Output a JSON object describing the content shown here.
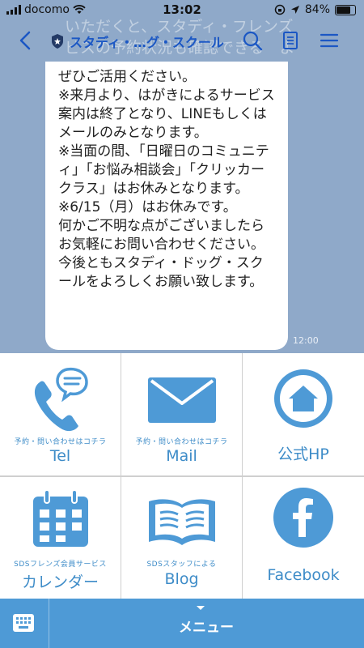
{
  "status": {
    "carrier": "docomo",
    "time": "13:02",
    "battery": "84%",
    "battery_level": 0.84
  },
  "header": {
    "title": "スタディ・…グ・スクール",
    "background_text": "いただくと、スタディ・フレンズ　ビスの予約状況も確認できる　ようになりました。"
  },
  "message": {
    "lines": [
      "ぜひご活用ください。",
      "",
      "※来月より、はがきによるサービス案内は終了となり、LINEもしくはメールのみとなります。",
      "※当面の間、「日曜日のコミュニティ」「お悩み相談会」「クリッカークラス」はお休みとなります。",
      "※6/15（月）はお休みです。",
      "",
      "何かご不明な点がございましたらお気軽にお問い合わせください。",
      "今後ともスタディ・ドッグ・スクールをよろしくお願い致します。"
    ],
    "time": "12:00"
  },
  "menu": {
    "tel": {
      "small": "予約・問い合わせはコチラ",
      "label": "Tel"
    },
    "mail": {
      "small": "予約・問い合わせはコチラ",
      "label": "Mail"
    },
    "home": {
      "label": "公式HP"
    },
    "calendar": {
      "small": "SDSフレンズ会員サービス",
      "label": "カレンダー"
    },
    "blog": {
      "small": "SDSスタッフによる",
      "label": "Blog"
    },
    "facebook": {
      "label": "Facebook"
    }
  },
  "bottom": {
    "menu_label": "メニュー"
  },
  "colors": {
    "accent": "#3e8cc8",
    "bar": "#4e9ad6",
    "title": "#1b57c4"
  },
  "icons": [
    "back-arrow-icon",
    "shield-icon",
    "search-icon",
    "notes-icon",
    "hamburger-icon",
    "phone-icon",
    "mail-icon",
    "home-icon",
    "calendar-icon",
    "book-icon",
    "facebook-icon",
    "keyboard-icon"
  ]
}
